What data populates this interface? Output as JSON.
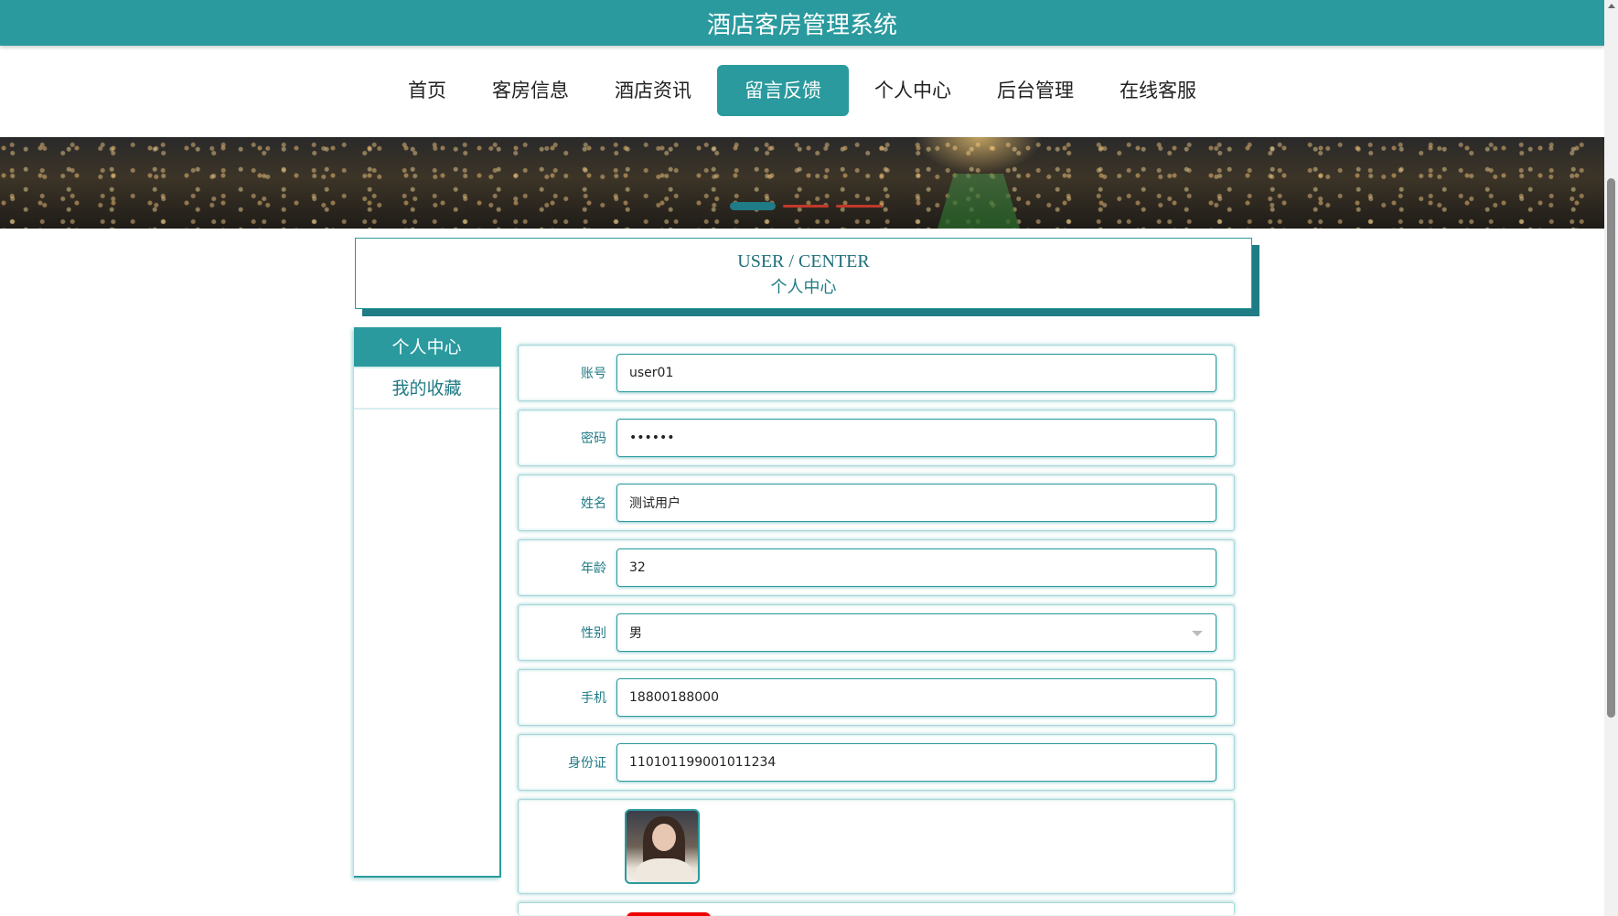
{
  "header": {
    "title": "酒店客房管理系统"
  },
  "nav": {
    "items": [
      {
        "label": "首页",
        "active": false
      },
      {
        "label": "客房信息",
        "active": false
      },
      {
        "label": "酒店资讯",
        "active": false
      },
      {
        "label": "留言反馈",
        "active": true
      },
      {
        "label": "个人中心",
        "active": false
      },
      {
        "label": "后台管理",
        "active": false
      },
      {
        "label": "在线客服",
        "active": false
      }
    ]
  },
  "banner": {
    "slide_count": 3,
    "active_slide": 1
  },
  "section": {
    "en_title": "USER / CENTER",
    "cn_title": "个人中心"
  },
  "sidebar": {
    "items": [
      {
        "label": "个人中心",
        "active": true
      },
      {
        "label": "我的收藏",
        "active": false
      }
    ]
  },
  "form": {
    "fields": [
      {
        "label": "账号",
        "value": "user01"
      },
      {
        "label": "密码",
        "value": "••••••"
      },
      {
        "label": "姓名",
        "value": "测试用户"
      },
      {
        "label": "年龄",
        "value": "32"
      },
      {
        "label": "性别",
        "value": "男"
      },
      {
        "label": "手机",
        "value": "18800188000"
      },
      {
        "label": "身份证",
        "value": "110101199001011234"
      }
    ]
  },
  "colors": {
    "accent": "#2a9a9e",
    "accent_dark": "#1f7b85",
    "danger": "#e00000"
  }
}
